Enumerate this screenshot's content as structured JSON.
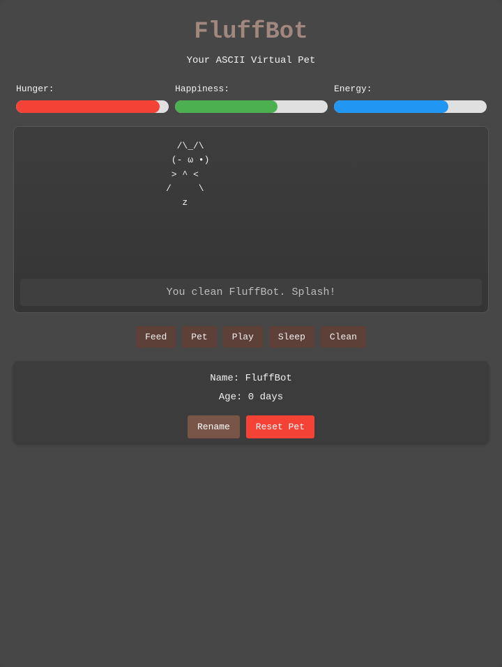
{
  "header": {
    "title": "FluffBot",
    "subtitle": "Your ASCII Virtual Pet",
    "title_color": "#a1887f"
  },
  "stats": [
    {
      "label": "Hunger:",
      "value": 0.94,
      "color": "#f44336"
    },
    {
      "label": "Happiness:",
      "value": 0.67,
      "color": "#4caf50"
    },
    {
      "label": "Energy:",
      "value": 0.75,
      "color": "#2196f3"
    }
  ],
  "pet": {
    "ascii": "  /\\_/\\\n (- ω •)\n > ^ <\n/     \\\n   z",
    "message": "You clean FluffBot. Splash!"
  },
  "actions": [
    {
      "label": "Feed"
    },
    {
      "label": "Pet"
    },
    {
      "label": "Play"
    },
    {
      "label": "Sleep"
    },
    {
      "label": "Clean"
    }
  ],
  "info": {
    "name_line": "Name: FluffBot",
    "age_line": "Age: 0 days",
    "rename_label": "Rename",
    "reset_label": "Reset Pet"
  }
}
